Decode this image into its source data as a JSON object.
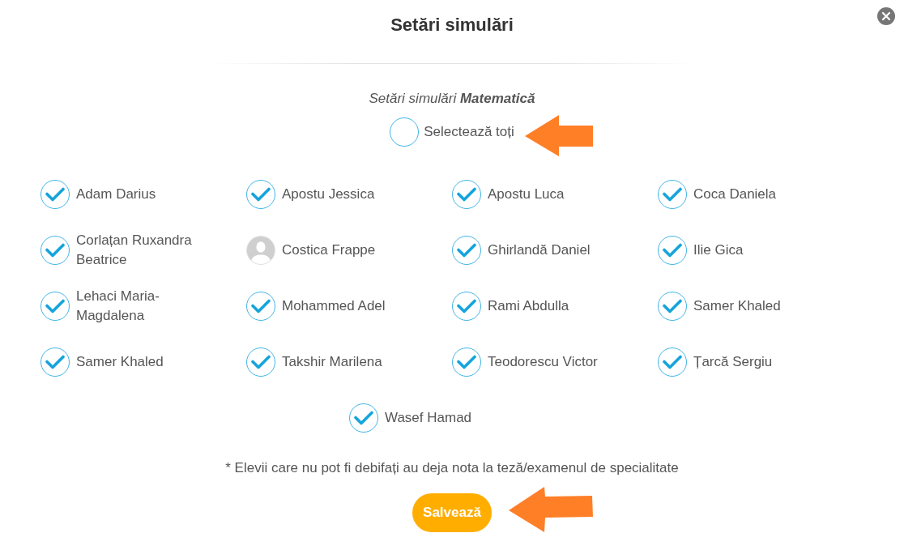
{
  "dialog": {
    "title": "Setări simulări",
    "subtitle": "Setări simulări **Matematică**"
  },
  "select_all": {
    "label": "Selectează toți",
    "checked": false
  },
  "students": [
    {
      "name": "Adam Darius",
      "kind": "checkbox",
      "checked": true
    },
    {
      "name": "Apostu Jessica",
      "kind": "checkbox",
      "checked": true
    },
    {
      "name": "Apostu Luca",
      "kind": "checkbox",
      "checked": true
    },
    {
      "name": "Coca Daniela",
      "kind": "checkbox",
      "checked": true
    },
    {
      "name": "Corlațan Ruxandra Beatrice",
      "kind": "checkbox",
      "checked": true
    },
    {
      "name": "Costica Frappe",
      "kind": "locked"
    },
    {
      "name": "Ghirlandă Daniel",
      "kind": "checkbox",
      "checked": true
    },
    {
      "name": "Ilie Gica",
      "kind": "checkbox",
      "checked": true
    },
    {
      "name": "Lehaci Maria-Magdalena",
      "kind": "checkbox",
      "checked": true
    },
    {
      "name": "Mohammed Adel",
      "kind": "checkbox",
      "checked": true
    },
    {
      "name": "Rami Abdulla",
      "kind": "checkbox",
      "checked": true
    },
    {
      "name": "Samer Khaled",
      "kind": "checkbox",
      "checked": true
    },
    {
      "name": "Samer Khaled",
      "kind": "checkbox",
      "checked": true
    },
    {
      "name": "Takshir Marilena",
      "kind": "checkbox",
      "checked": true
    },
    {
      "name": "Teodorescu Victor",
      "kind": "checkbox",
      "checked": true
    },
    {
      "name": "Țarcă Sergiu",
      "kind": "checkbox",
      "checked": true
    },
    {
      "name": "Wasef Hamad",
      "kind": "checkbox",
      "checked": true
    }
  ],
  "footnote": "* Elevii care nu pot fi debifați au deja nota la teză/examenul de specialitate",
  "save_button": "Salvează"
}
